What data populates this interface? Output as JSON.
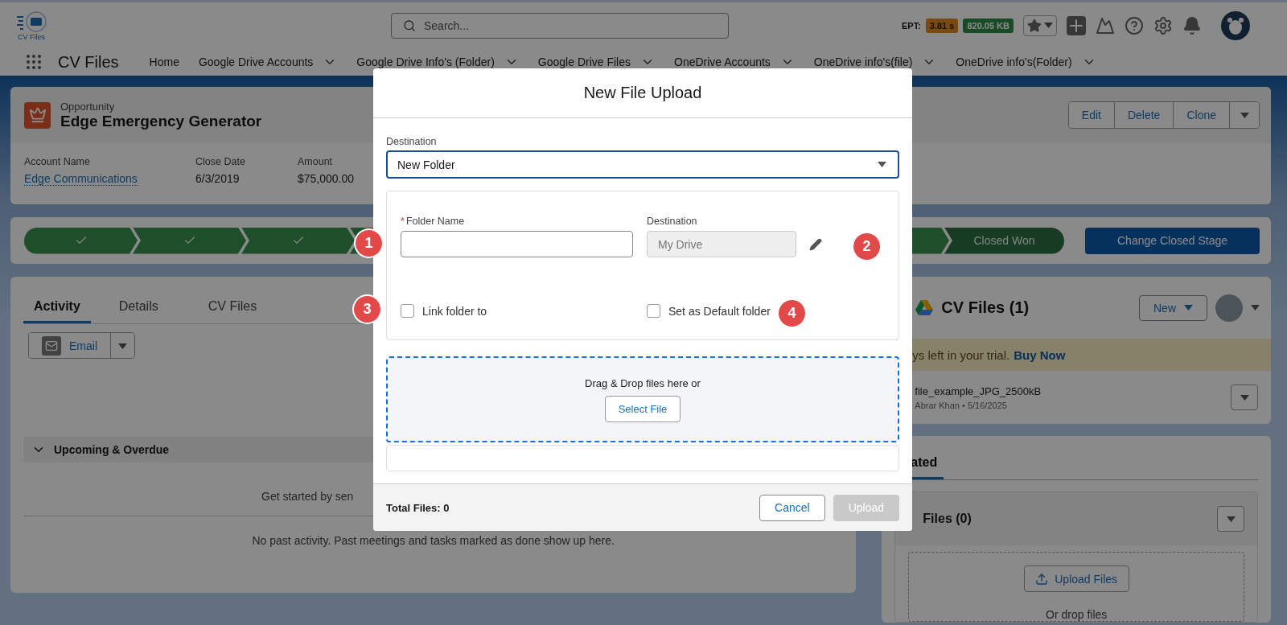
{
  "top_bar": {
    "logo_text": "CV Files",
    "search": {
      "placeholder": "Search..."
    },
    "ept": {
      "label": "EPT:",
      "time": "3.81 s",
      "size": "820.05 KB"
    }
  },
  "nav": {
    "app_name": "CV Files",
    "items": [
      {
        "label": "Home",
        "menu": false
      },
      {
        "label": "Google Drive Accounts",
        "menu": true
      },
      {
        "label": "Google Drive Info's (Folder)",
        "menu": true
      },
      {
        "label": "Google Drive Files",
        "menu": true
      },
      {
        "label": "OneDrive Accounts",
        "menu": true
      },
      {
        "label": "OneDrive info's(file)",
        "menu": true
      },
      {
        "label": "OneDrive info's(Folder)",
        "menu": true
      }
    ]
  },
  "record": {
    "object": "Opportunity",
    "title": "Edge Emergency Generator",
    "actions": [
      "Edit",
      "Delete",
      "Clone"
    ],
    "fields": [
      {
        "label": "Account Name",
        "value": "Edge Communications",
        "kind": "link"
      },
      {
        "label": "Close Date",
        "value": "6/3/2019",
        "kind": "text"
      },
      {
        "label": "Amount",
        "value": "$75,000.00",
        "kind": "text"
      }
    ]
  },
  "path": {
    "stages": [
      {
        "kind": "done"
      },
      {
        "kind": "done"
      },
      {
        "kind": "done"
      },
      {
        "kind": "partial"
      },
      {
        "kind": "current",
        "label": "Closed Won"
      }
    ],
    "button": "Change Closed Stage"
  },
  "activity": {
    "tabs": [
      {
        "label": "Activity",
        "selected": true
      },
      {
        "label": "Details",
        "selected": false
      },
      {
        "label": "CV Files",
        "selected": false
      }
    ],
    "email_button": "Email",
    "section": {
      "title": "Upcoming & Overdue",
      "expanded": true
    },
    "upcoming_text": "Get started by sen",
    "past_text": "No past activity. Past meetings and tasks marked as done show up here."
  },
  "cv_files_card": {
    "title": "CV Files (1)",
    "new_button": "New",
    "trial_text": "ys left in your trial.",
    "trial_link": "Buy Now",
    "files": [
      {
        "name": "file_example_JPG_2500kB",
        "meta": "Abrar Khan • 5/16/2025"
      }
    ]
  },
  "related": {
    "tab": "ated",
    "files_title": "Files (0)",
    "upload_button": "Upload Files",
    "drop_text": "Or drop files"
  },
  "modal": {
    "title": "New File Upload",
    "destination": {
      "label": "Destination",
      "value": "New Folder"
    },
    "folder_name": {
      "label": "Folder Name",
      "required": true,
      "required_mark": "*"
    },
    "folder_destination": {
      "label": "Destination",
      "value": "My Drive",
      "disabled": true
    },
    "options": [
      {
        "label": "Link folder to",
        "checked": false
      },
      {
        "label": "Set as Default folder",
        "checked": false
      }
    ],
    "dropzone": {
      "text": "Drag & Drop files here or",
      "button": "Select File"
    },
    "total": "Total Files: 0",
    "buttons": [
      {
        "label": "Cancel",
        "kind": "secondary",
        "disabled": false
      },
      {
        "label": "Upload",
        "kind": "primary",
        "disabled": true
      }
    ]
  },
  "annotations": [
    "1",
    "2",
    "3",
    "4"
  ]
}
